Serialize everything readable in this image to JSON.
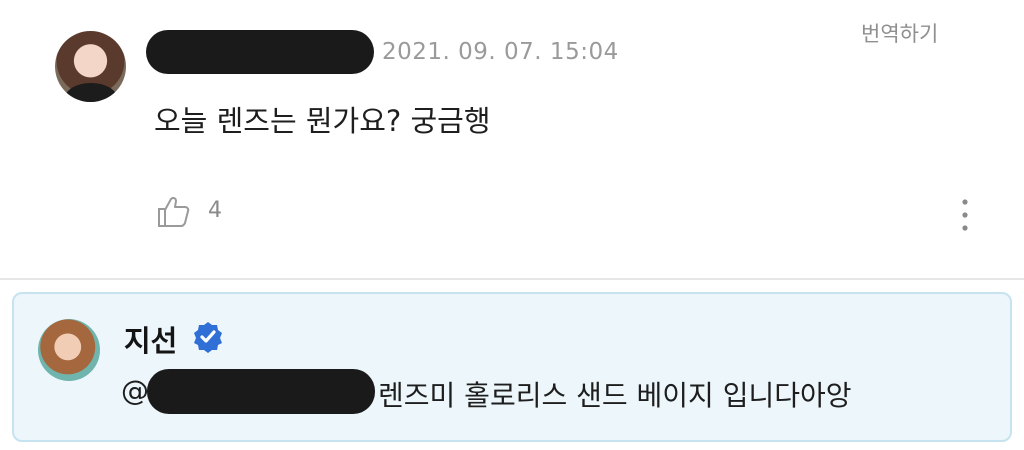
{
  "comment": {
    "timestamp": "2021. 09. 07. 15:04",
    "translate_label": "번역하기",
    "text": "오늘 렌즈는 뭔가요? 궁금행",
    "like_count": "4"
  },
  "reply": {
    "author_name": "지선",
    "mention_prefix": "@",
    "text": "렌즈미 홀로리스 샌드 베이지 입니다아앙"
  },
  "icons": {
    "like": "thumbs-up-icon",
    "more": "vertical-dots-icon",
    "verified": "verified-badge-icon"
  },
  "colors": {
    "reply_background": "#ecf6fb",
    "reply_border": "#c7e3ef",
    "verified_badge": "#2f6fd6",
    "muted_text": "#9a9a9a"
  }
}
